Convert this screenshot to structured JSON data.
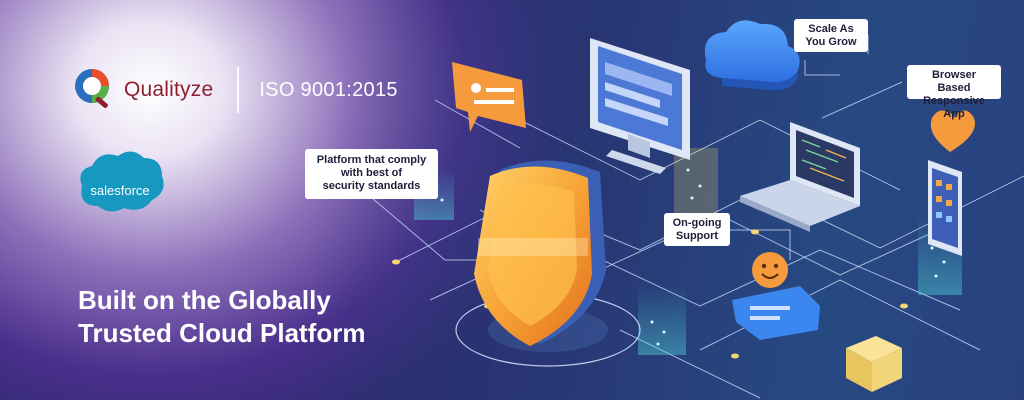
{
  "brand": {
    "name": "Qualityze",
    "certification": "ISO 9001:2015",
    "partner_logo_text": "salesforce",
    "colors": {
      "qualityze_red": "#8f1f2f",
      "salesforce_blue": "#1798c1"
    }
  },
  "headline": {
    "line1": "Built on the Globally",
    "line2": "Trusted Cloud Platform"
  },
  "callouts": {
    "security": {
      "line1": "Platform that comply",
      "line2": "with best of",
      "line3": "security standards"
    },
    "scale": {
      "line1": "Scale As",
      "line2": "You Grow"
    },
    "browser": {
      "line1": "Browser Based",
      "line2": "Responsive App"
    },
    "support": {
      "line1": "On-going",
      "line2": "Support"
    }
  },
  "icons": [
    "qualityze-logo-icon",
    "salesforce-cloud-icon",
    "shield-icon",
    "cloud-icon",
    "monitor-icon",
    "laptop-icon",
    "smartphone-icon",
    "chat-bubble-icon",
    "smiley-chat-icon",
    "heart-icon"
  ]
}
